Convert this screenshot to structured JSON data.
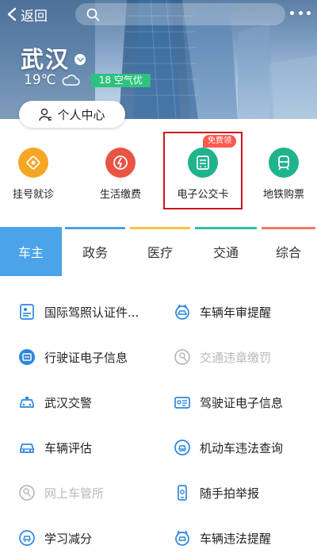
{
  "header": {
    "back_label": "返回",
    "city": "武汉",
    "temperature": "19℃",
    "aqi": "18 空气优",
    "personal_center": "个人中心"
  },
  "quick_services": [
    {
      "label": "挂号就诊",
      "icon": "hospital-registration-icon",
      "color": "#f6a623"
    },
    {
      "label": "生活缴费",
      "icon": "utility-payment-icon",
      "color": "#ea5444"
    },
    {
      "label": "电子公交卡",
      "icon": "bus-card-icon",
      "color": "#1fb38e",
      "badge": "免费领",
      "highlighted": true
    },
    {
      "label": "地铁购票",
      "icon": "metro-ticket-icon",
      "color": "#1fb38e"
    }
  ],
  "tabs": [
    {
      "label": "车主",
      "active": true,
      "bar_color": "#4ba3e9"
    },
    {
      "label": "政务",
      "active": false,
      "bar_color": "#4ba3e9"
    },
    {
      "label": "医疗",
      "active": false,
      "bar_color": "#f6c343"
    },
    {
      "label": "交通",
      "active": false,
      "bar_color": "#2ec2a3"
    },
    {
      "label": "综合",
      "active": false,
      "bar_color": "#f2796b"
    }
  ],
  "services": [
    {
      "label": "国际驾照认证件...",
      "icon": "license-doc-icon",
      "enabled": true
    },
    {
      "label": "车辆年审提醒",
      "icon": "car-inspection-icon",
      "enabled": true
    },
    {
      "label": "行驶证电子信息",
      "icon": "vehicle-license-icon",
      "enabled": true
    },
    {
      "label": "交通违章缴罚",
      "icon": "traffic-fine-icon",
      "enabled": false
    },
    {
      "label": "武汉交警",
      "icon": "police-car-icon",
      "enabled": true
    },
    {
      "label": "驾驶证电子信息",
      "icon": "driver-license-icon",
      "enabled": true
    },
    {
      "label": "车辆评估",
      "icon": "car-evaluation-icon",
      "enabled": true
    },
    {
      "label": "机动车违法查询",
      "icon": "violation-query-icon",
      "enabled": true
    },
    {
      "label": "网上车管所",
      "icon": "online-dmv-icon",
      "enabled": false
    },
    {
      "label": "随手拍举报",
      "icon": "phone-report-icon",
      "enabled": true
    },
    {
      "label": "学习减分",
      "icon": "study-points-icon",
      "enabled": true
    },
    {
      "label": "车辆违法提醒",
      "icon": "violation-alert-icon",
      "enabled": true
    }
  ],
  "colors": {
    "accent": "#4ba3e9",
    "service_icon": "#2b86e0",
    "disabled": "#b9b9b9",
    "highlight_border": "#c8161d"
  }
}
